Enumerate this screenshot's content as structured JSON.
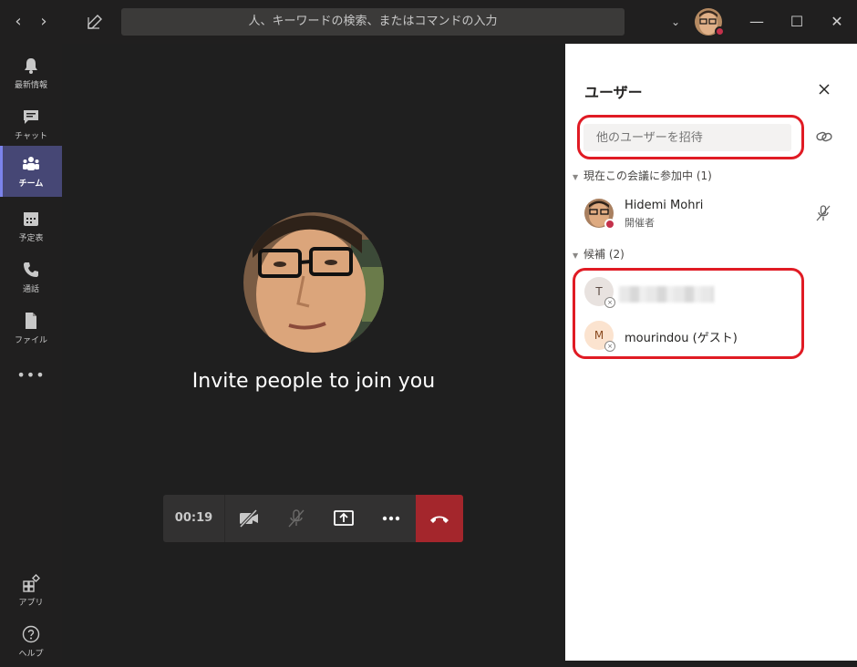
{
  "titlebar": {
    "back_icon": "chevron-left-icon",
    "forward_icon": "chevron-right-icon",
    "back_glyph": "‹",
    "forward_glyph": "›",
    "search_placeholder": "人、キーワードの検索、またはコマンドの入力",
    "dropdown_glyph": "⌄",
    "minimize_glyph": "—",
    "maximize_glyph": "☐",
    "close_glyph": "✕"
  },
  "rail": {
    "items": [
      {
        "label": "最新情報",
        "icon": "bell-icon"
      },
      {
        "label": "チャット",
        "icon": "chat-icon"
      },
      {
        "label": "チーム",
        "icon": "teams-icon",
        "active": true
      },
      {
        "label": "予定表",
        "icon": "calendar-icon"
      },
      {
        "label": "通話",
        "icon": "phone-icon"
      },
      {
        "label": "ファイル",
        "icon": "file-icon"
      },
      {
        "label": "",
        "icon": "more-icon",
        "glyph": "•••"
      }
    ],
    "bottom": [
      {
        "label": "アプリ",
        "icon": "apps-icon"
      },
      {
        "label": "ヘルプ",
        "icon": "help-icon"
      }
    ]
  },
  "stage": {
    "invite_text": "Invite people to join you",
    "timer": "00:19",
    "hangup_color": "#a4262c"
  },
  "panel": {
    "title": "ユーザー",
    "invite_placeholder": "他のユーザーを招待",
    "in_meeting_label": "現在この会議に参加中",
    "in_meeting_count": "(1)",
    "participants": [
      {
        "name": "Hidemi Mohri",
        "role": "開催者"
      }
    ],
    "suggested_label": "候補",
    "suggested_count": "(2)",
    "suggested": [
      {
        "initial": "T",
        "name": "",
        "bg": "#e8e2df"
      },
      {
        "initial": "M",
        "name": "mourindou (ゲスト)",
        "bg": "#fbe3cf"
      }
    ]
  },
  "colors": {
    "accent": "#464775",
    "highlight_ring": "#e01b24",
    "status_busy": "#c4314b"
  }
}
